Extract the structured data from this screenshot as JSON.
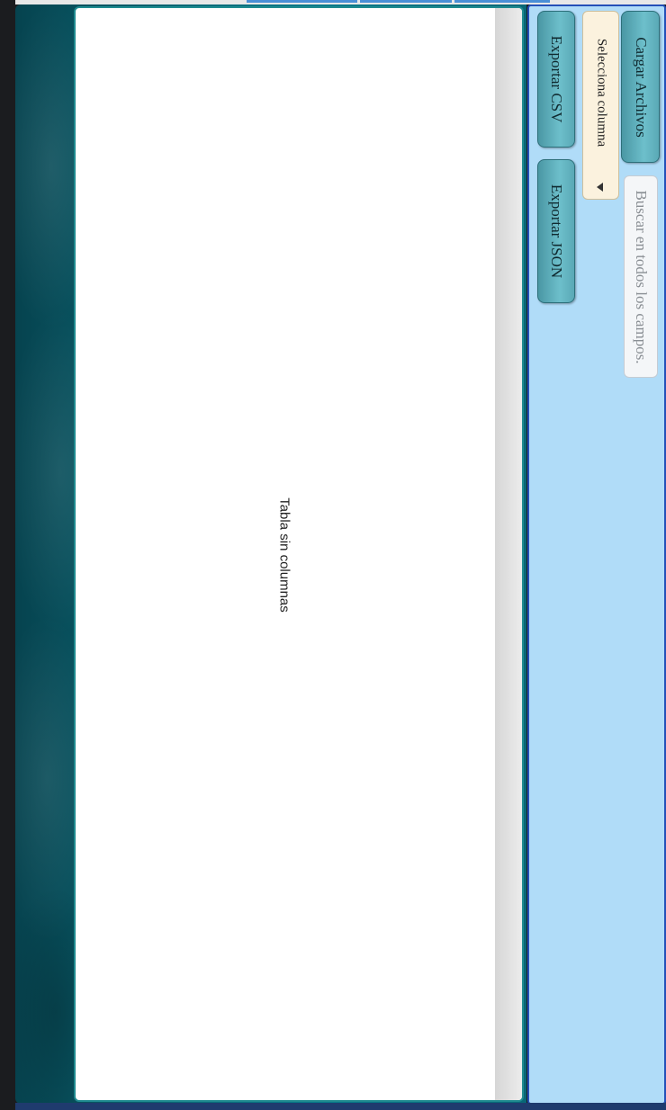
{
  "toolbar": {
    "load_label": "Cargar Archivos",
    "search_placeholder": "Buscar en todos los campos.",
    "column_select_value": "Selecciona columna",
    "export_csv_label": "Exportar CSV",
    "export_json_label": "Exportar JSON"
  },
  "table": {
    "empty_message": "Tabla sin columnas"
  },
  "icons": {
    "select_caret": "caret-left-icon"
  },
  "colors": {
    "button_teal": "#5aa9b6",
    "panel_blue": "#b0dcf8",
    "panel_border": "#2450b8",
    "table_border": "#1f8a8f"
  }
}
